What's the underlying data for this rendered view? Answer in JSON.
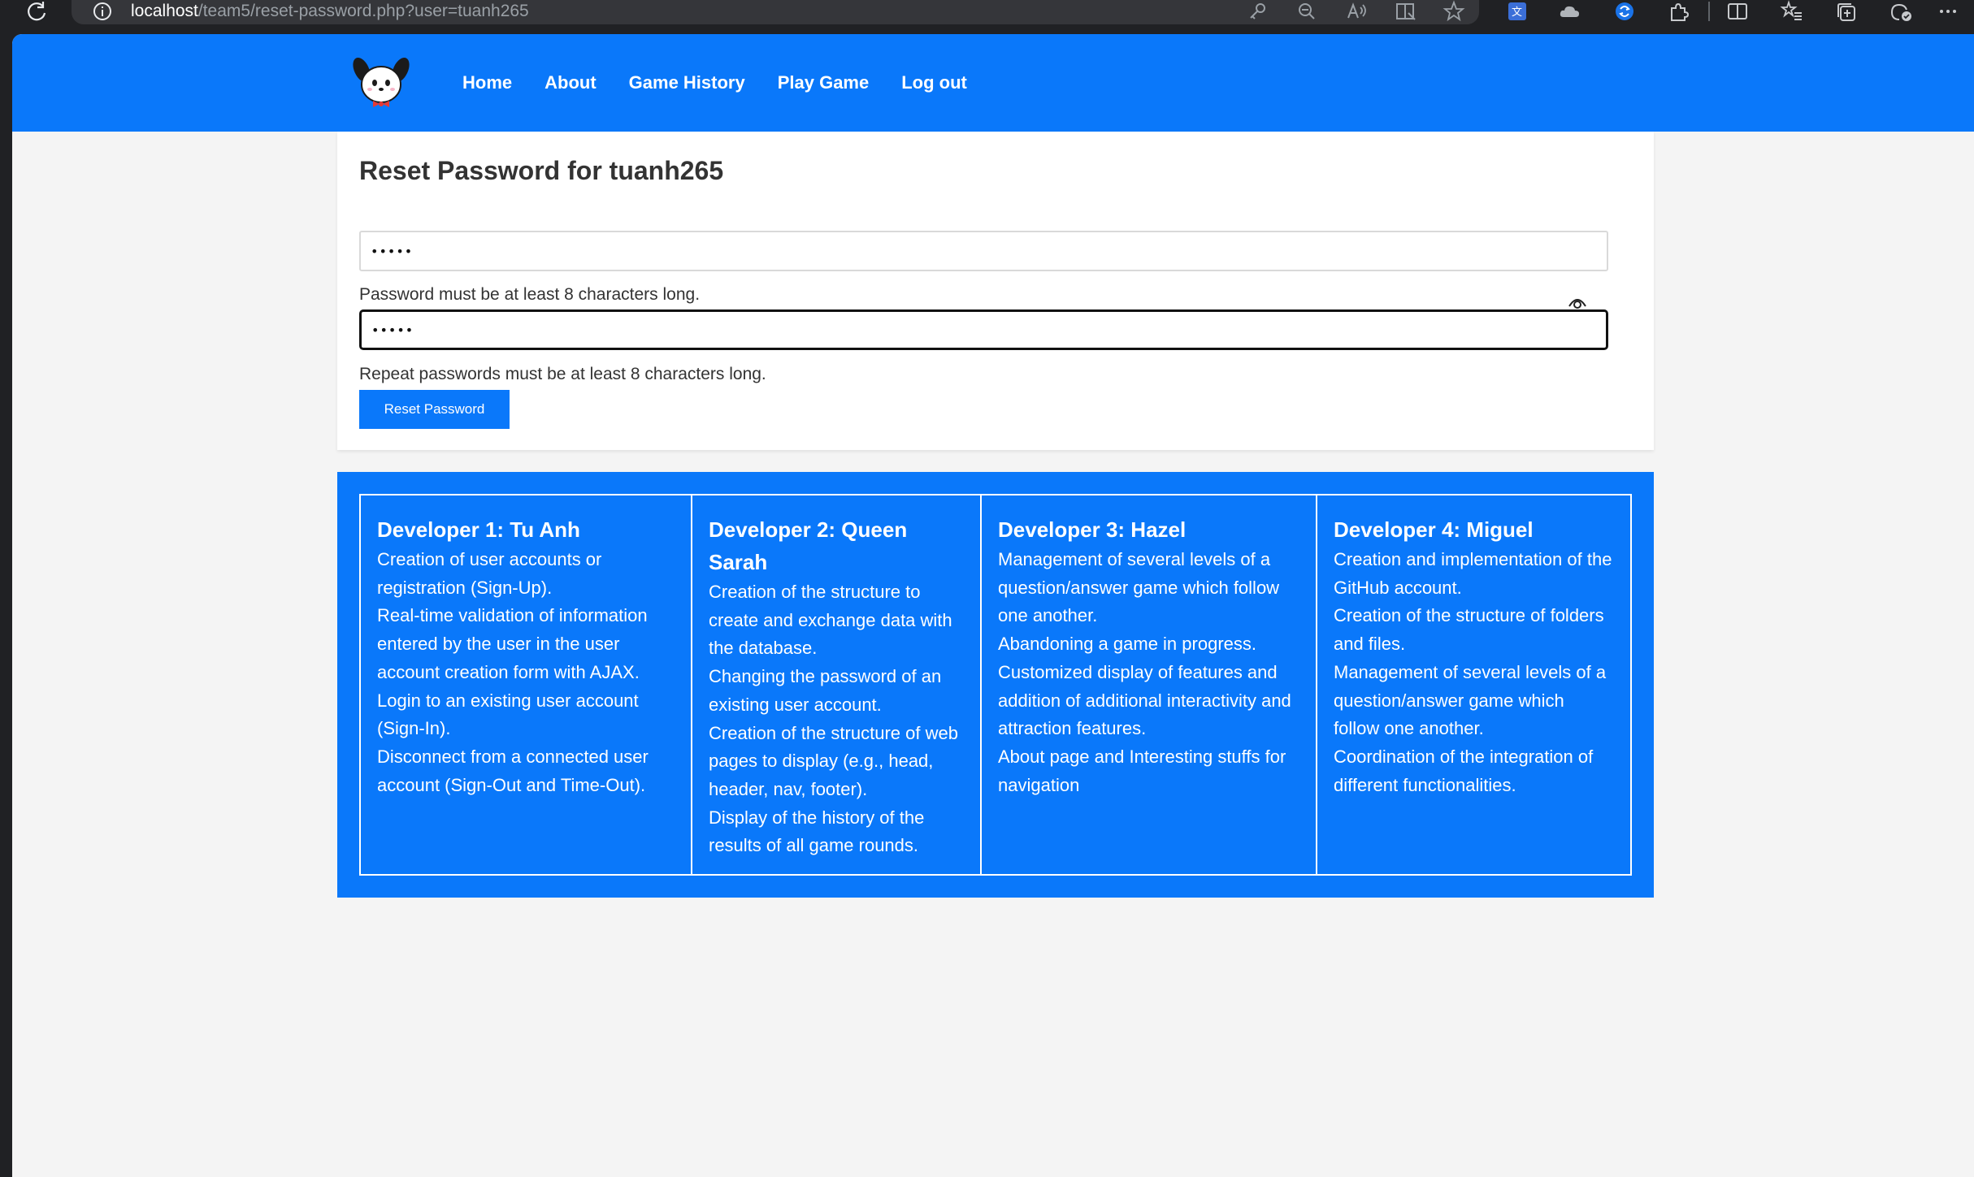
{
  "browser": {
    "url_host": "localhost",
    "url_path": "/team5/reset-password.php?user=tuanh265"
  },
  "nav": {
    "links": [
      "Home",
      "About",
      "Game History",
      "Play Game",
      "Log out"
    ]
  },
  "form": {
    "title": "Reset Password for tuanh265",
    "password_value": "•••••",
    "password_hint": "Password must be at least 8 characters long.",
    "repeat_value": "•••••",
    "repeat_hint": "Repeat passwords must be at least 8 characters long.",
    "submit_label": "Reset Password"
  },
  "developers": [
    {
      "title": "Developer 1: Tu Anh",
      "tasks": [
        "Creation of user accounts or registration (Sign-Up).",
        "Real-time validation of information entered by the user in the user account creation form with AJAX.",
        "Login to an existing user account (Sign-In).",
        "Disconnect from a connected user account (Sign-Out and Time-Out)."
      ]
    },
    {
      "title": "Developer 2: Queen Sarah",
      "tasks": [
        "Creation of the structure to create and exchange data with the database.",
        "Changing the password of an existing user account.",
        "Creation of the structure of web pages to display (e.g., head, header, nav, footer).",
        "Display of the history of the results of all game rounds."
      ]
    },
    {
      "title": "Developer 3: Hazel",
      "tasks": [
        "Management of several levels of a question/answer game which follow one another.",
        "Abandoning a game in progress.",
        "Customized display of features and addition of additional interactivity and attraction features.",
        "About page and Interesting stuffs for navigation"
      ]
    },
    {
      "title": "Developer 4: Miguel",
      "tasks": [
        "Creation and implementation of the GitHub account.",
        "Creation of the structure of folders and files.",
        "Management of several levels of a question/answer game which follow one another.",
        "Coordination of the integration of different functionalities."
      ]
    }
  ],
  "colors": {
    "brand_blue": "#0a78fa",
    "page_bg": "#f4f4f4",
    "card_bg": "#ffffff"
  },
  "icons": {
    "browser": [
      "reload-icon",
      "info-icon",
      "key-icon",
      "zoom-out-icon",
      "read-aloud-icon",
      "immersive-reader-icon",
      "favorite-star-icon",
      "translate-extension-icon",
      "cloud-extension-icon",
      "blue-extension-icon",
      "extensions-icon",
      "split-screen-icon",
      "favorites-icon",
      "collections-icon",
      "performance-icon",
      "more-menu-icon"
    ],
    "page": [
      "mascot-logo-icon",
      "eye-icon"
    ]
  }
}
